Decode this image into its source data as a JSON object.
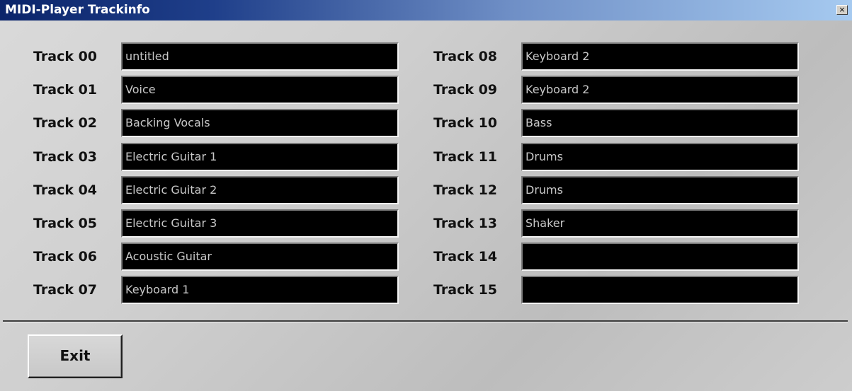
{
  "window": {
    "title": "MIDI-Player Trackinfo",
    "close_glyph": "×"
  },
  "tracks": [
    {
      "label": "Track 00",
      "name": "untitled"
    },
    {
      "label": "Track 01",
      "name": "Voice"
    },
    {
      "label": "Track 02",
      "name": "Backing Vocals"
    },
    {
      "label": "Track 03",
      "name": "Electric Guitar 1"
    },
    {
      "label": "Track 04",
      "name": "Electric Guitar 2"
    },
    {
      "label": "Track 05",
      "name": "Electric Guitar 3"
    },
    {
      "label": "Track 06",
      "name": "Acoustic Guitar"
    },
    {
      "label": "Track 07",
      "name": "Keyboard 1"
    },
    {
      "label": "Track 08",
      "name": "Keyboard 2"
    },
    {
      "label": "Track 09",
      "name": "Keyboard 2"
    },
    {
      "label": "Track 10",
      "name": "Bass"
    },
    {
      "label": "Track 11",
      "name": "Drums"
    },
    {
      "label": "Track 12",
      "name": "Drums"
    },
    {
      "label": "Track 13",
      "name": "Shaker"
    },
    {
      "label": "Track 14",
      "name": ""
    },
    {
      "label": "Track 15",
      "name": ""
    }
  ],
  "footer": {
    "exit_label": "Exit"
  },
  "colors": {
    "title_bar_start": "#0b246a",
    "title_bar_end": "#a6caf0",
    "field_background": "#000000",
    "field_text": "#c8c8c8"
  }
}
